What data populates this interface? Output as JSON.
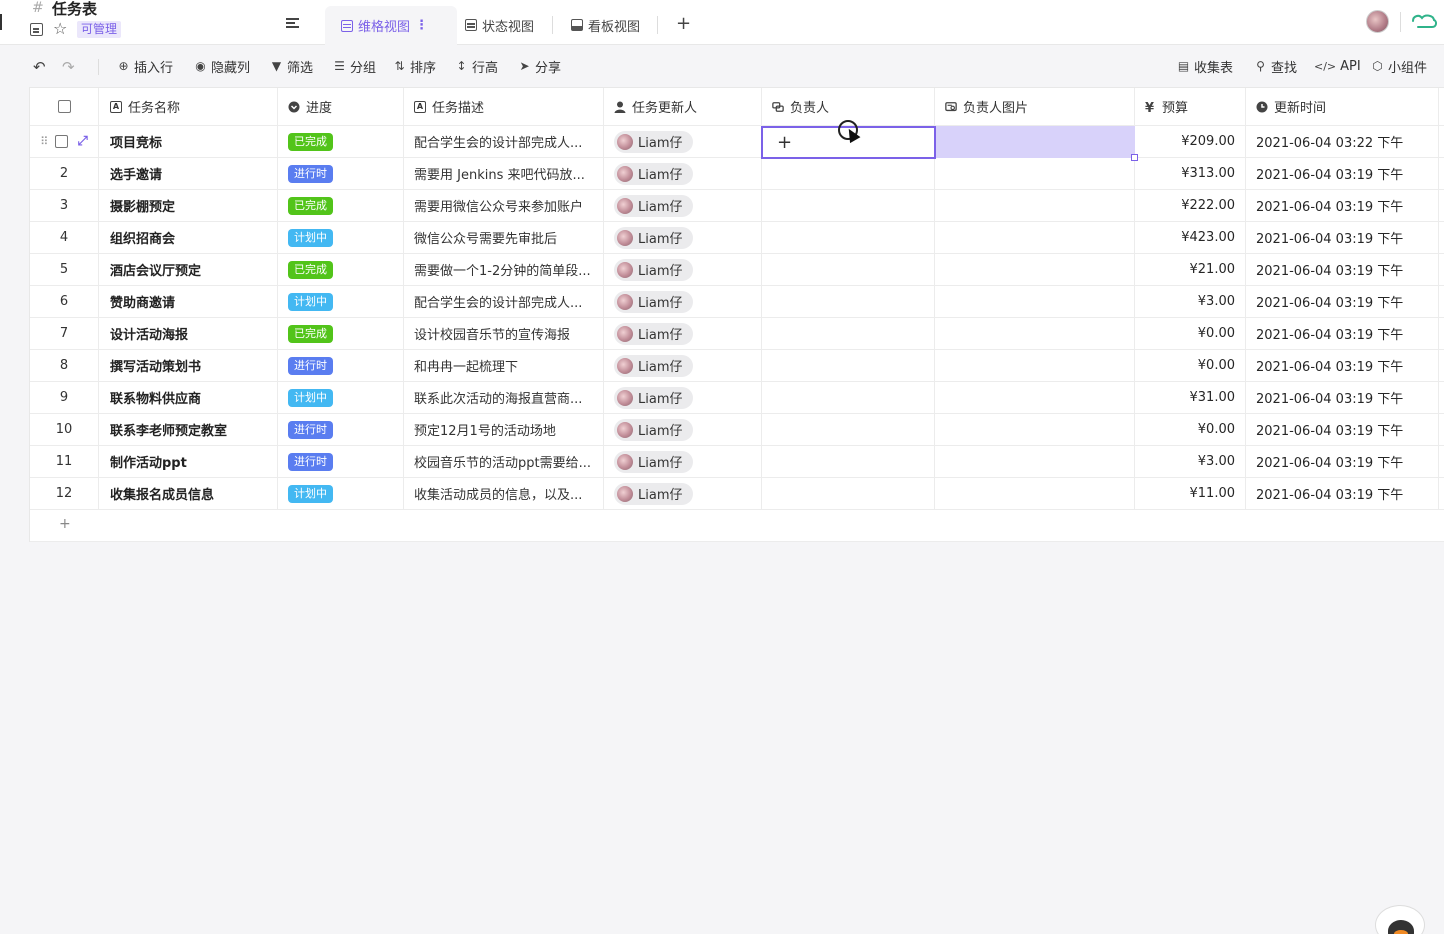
{
  "header": {
    "title_glyph": "#",
    "title": "任务表",
    "badge": "可管理",
    "tabs": [
      {
        "label": "维格视图",
        "more": "⋮",
        "active": true
      },
      {
        "label": "状态视图",
        "active": false
      },
      {
        "label": "看板视图",
        "active": false
      }
    ],
    "add_tab": "+"
  },
  "toolbar": {
    "undo": "↶",
    "redo": "↷",
    "items": [
      {
        "label": "插入行",
        "icon": "⊕"
      },
      {
        "label": "隐藏列",
        "icon": "◉"
      },
      {
        "label": "筛选",
        "icon": "▼"
      },
      {
        "label": "分组",
        "icon": "☰"
      },
      {
        "label": "排序",
        "icon": "⇅"
      },
      {
        "label": "行高",
        "icon": "↕"
      },
      {
        "label": "分享",
        "icon": "➤"
      }
    ],
    "right_items": [
      {
        "label": "收集表",
        "icon": "▤"
      },
      {
        "label": "查找",
        "icon": "⚲"
      },
      {
        "label": "API",
        "icon": "</>"
      },
      {
        "label": "小组件",
        "icon": "⬡"
      }
    ]
  },
  "table": {
    "columns": {
      "name": "任务名称",
      "progress": "进度",
      "desc": "任务描述",
      "updater": "任务更新人",
      "owner": "负责人",
      "owner_img": "负责人图片",
      "budget": "预算",
      "time": "更新时间"
    },
    "column_icons": {
      "name": "A",
      "desc": "A",
      "budget": "¥"
    },
    "status_colors": {
      "已完成": "#52c41a",
      "进行时": "#5a7df0",
      "计划中": "#43b8f2"
    },
    "rows": [
      {
        "idx": "1",
        "name": "项目竞标",
        "status": "已完成",
        "desc": "配合学生会的设计部完成人...",
        "updater": "Liam仔",
        "budget": "¥209.00",
        "time": "2021-06-04  03:22  下午"
      },
      {
        "idx": "2",
        "name": "选手邀请",
        "status": "进行时",
        "desc": "需要用 Jenkins 来吧代码放...",
        "updater": "Liam仔",
        "budget": "¥313.00",
        "time": "2021-06-04  03:19  下午"
      },
      {
        "idx": "3",
        "name": "摄影棚预定",
        "status": "已完成",
        "desc": "需要用微信公众号来参加账户",
        "updater": "Liam仔",
        "budget": "¥222.00",
        "time": "2021-06-04  03:19  下午"
      },
      {
        "idx": "4",
        "name": "组织招商会",
        "status": "计划中",
        "desc": "微信公众号需要先审批后",
        "updater": "Liam仔",
        "budget": "¥423.00",
        "time": "2021-06-04  03:19  下午"
      },
      {
        "idx": "5",
        "name": "酒店会议厅预定",
        "status": "已完成",
        "desc": "需要做一个1-2分钟的简单段...",
        "updater": "Liam仔",
        "budget": "¥21.00",
        "time": "2021-06-04  03:19  下午"
      },
      {
        "idx": "6",
        "name": "赞助商邀请",
        "status": "计划中",
        "desc": "配合学生会的设计部完成人...",
        "updater": "Liam仔",
        "budget": "¥3.00",
        "time": "2021-06-04  03:19  下午"
      },
      {
        "idx": "7",
        "name": "设计活动海报",
        "status": "已完成",
        "desc": "设计校园音乐节的宣传海报",
        "updater": "Liam仔",
        "budget": "¥0.00",
        "time": "2021-06-04  03:19  下午"
      },
      {
        "idx": "8",
        "name": "撰写活动策划书",
        "status": "进行时",
        "desc": "和冉冉一起梳理下",
        "updater": "Liam仔",
        "budget": "¥0.00",
        "time": "2021-06-04  03:19  下午"
      },
      {
        "idx": "9",
        "name": "联系物料供应商",
        "status": "计划中",
        "desc": "联系此次活动的海报直营商...",
        "updater": "Liam仔",
        "budget": "¥31.00",
        "time": "2021-06-04  03:19  下午"
      },
      {
        "idx": "10",
        "name": "联系李老师预定教室",
        "status": "进行时",
        "desc": "预定12月1号的活动场地",
        "updater": "Liam仔",
        "budget": "¥0.00",
        "time": "2021-06-04  03:19  下午"
      },
      {
        "idx": "11",
        "name": "制作活动ppt",
        "status": "进行时",
        "desc": "校园音乐节的活动ppt需要给...",
        "updater": "Liam仔",
        "budget": "¥3.00",
        "time": "2021-06-04  03:19  下午"
      },
      {
        "idx": "12",
        "name": "收集报名成员信息",
        "status": "计划中",
        "desc": "收集活动成员的信息，以及...",
        "updater": "Liam仔",
        "budget": "¥11.00",
        "time": "2021-06-04  03:19  下午"
      }
    ],
    "add_row": "+",
    "selected_cell_content": "+"
  }
}
